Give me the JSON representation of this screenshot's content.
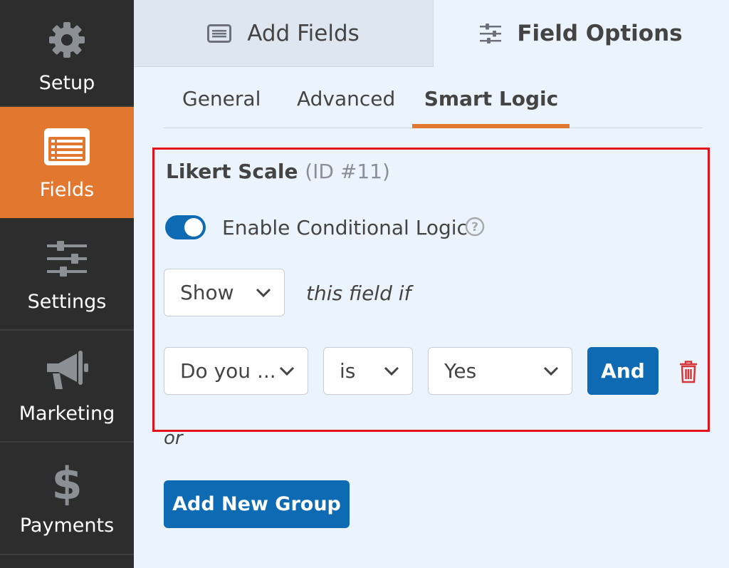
{
  "sidebar": {
    "items": [
      {
        "label": "Setup",
        "icon": "gear-icon"
      },
      {
        "label": "Fields",
        "icon": "list-form-icon",
        "active": true
      },
      {
        "label": "Settings",
        "icon": "sliders-icon"
      },
      {
        "label": "Marketing",
        "icon": "megaphone-icon"
      },
      {
        "label": "Payments",
        "icon": "dollar-icon"
      }
    ]
  },
  "top_tabs": {
    "add_fields": "Add Fields",
    "field_options": "Field Options"
  },
  "sub_tabs": {
    "general": "General",
    "advanced": "Advanced",
    "smart_logic": "Smart Logic"
  },
  "field": {
    "name": "Likert Scale",
    "id_text": "(ID #11)"
  },
  "conditional": {
    "toggle_label": "Enable Conditional Logic",
    "toggle_on": true,
    "action": "Show",
    "this_field_if": "this field if",
    "rule": {
      "field": "Do you ...",
      "operator": "is",
      "value": "Yes"
    },
    "and_label": "And",
    "or_text": "or",
    "add_group_label": "Add New Group"
  },
  "colors": {
    "accent": "#e27730",
    "primary": "#0e6ab3",
    "highlight": "#e3121b",
    "sidebar_bg": "#2d2d2d",
    "delete": "#d63638"
  }
}
